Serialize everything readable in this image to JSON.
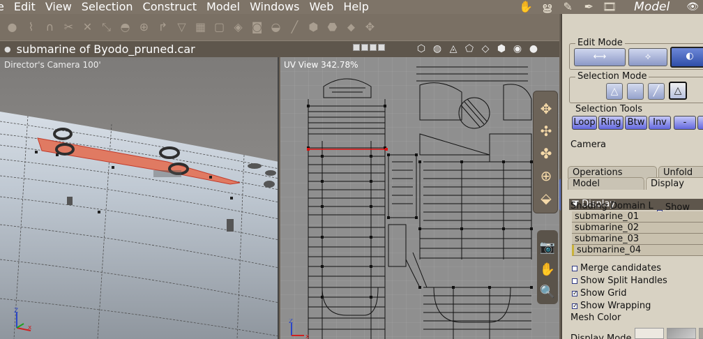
{
  "menu": [
    "e",
    "Edit",
    "View",
    "Selection",
    "Construct",
    "Model",
    "Windows",
    "Web",
    "Help"
  ],
  "mode_label": "Model",
  "window_title": "submarine of Byodo_pruned.car",
  "viewports": {
    "perspective_label": "Director's Camera 100'",
    "uv_label": "UV View 342.78%",
    "axis_z": "Z",
    "axis_x": "x"
  },
  "panel": {
    "edit_mode_title": "Edit Mode",
    "selection_mode_title": "Selection Mode",
    "selection_tools_title": "Selection Tools",
    "selection_tools": [
      "Loop",
      "Ring",
      "Btw",
      "Inv",
      "-"
    ],
    "camera_label": "Camera",
    "tabs": [
      "Operations",
      "Unfold",
      "Model",
      "Display"
    ],
    "display_header": "Display",
    "shading_domain_label": "Shading Domain L",
    "show_all_label": "Show All",
    "domains": [
      "submarine_01",
      "submarine_02",
      "submarine_03",
      "submarine_04"
    ],
    "options": [
      {
        "label": "Merge candidates",
        "checked": false
      },
      {
        "label": "Show Split Handles",
        "checked": false
      },
      {
        "label": "Show Grid",
        "checked": true
      },
      {
        "label": "Show Wrapping",
        "checked": true
      }
    ],
    "mesh_color_label": "Mesh Color",
    "display_mode_label": "Display Mode"
  },
  "colors": {
    "selection_highlight": "#e07a62",
    "uv_grid_bg": "#8f8f8f",
    "panel_bg": "#d8d2c3",
    "button_blue": "#6368de"
  }
}
